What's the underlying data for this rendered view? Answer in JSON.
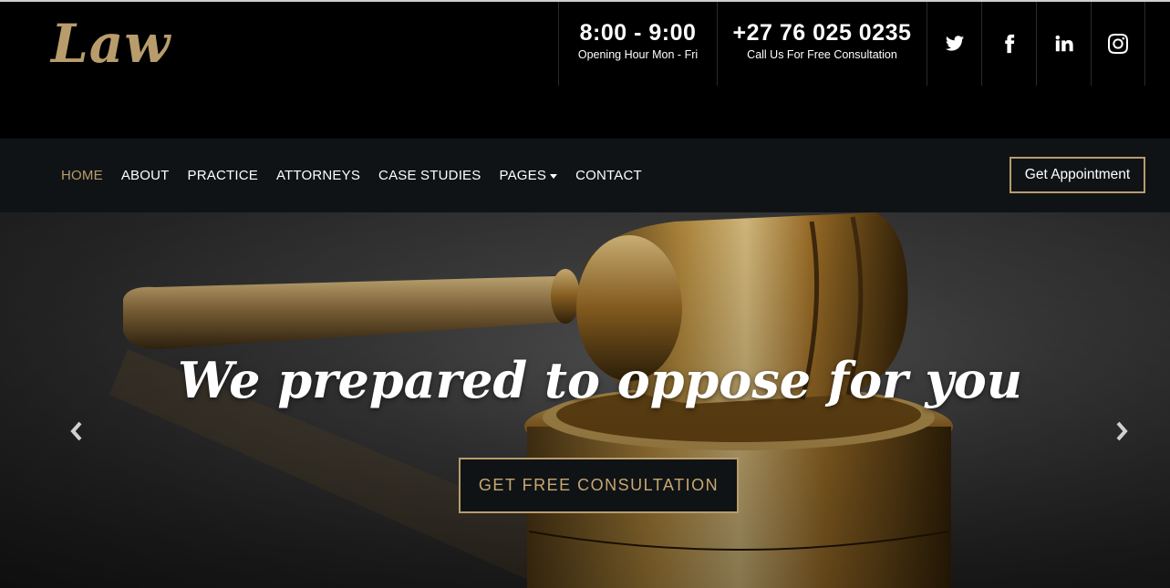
{
  "brand": {
    "logo_text": "Law",
    "accent_color": "#b89c6b"
  },
  "topbar": {
    "hours": {
      "main": "8:00 - 9:00",
      "sub": "Opening Hour Mon - Fri"
    },
    "phone": {
      "main": "+27 76 025 0235",
      "sub": "Call Us For Free Consultation"
    },
    "social": [
      "twitter-icon",
      "facebook-icon",
      "linkedin-icon",
      "instagram-icon"
    ]
  },
  "nav": {
    "items": [
      {
        "label": "HOME",
        "active": true
      },
      {
        "label": "ABOUT"
      },
      {
        "label": "PRACTICE"
      },
      {
        "label": "ATTORNEYS"
      },
      {
        "label": "CASE STUDIES"
      },
      {
        "label": "PAGES",
        "dropdown": true
      },
      {
        "label": "CONTACT"
      }
    ],
    "appointment_label": "Get Appointment"
  },
  "hero": {
    "title": "We prepared to oppose for you",
    "cta_label": "GET FREE CONSULTATION",
    "prev_icon": "chevron-left-icon",
    "next_icon": "chevron-right-icon"
  }
}
